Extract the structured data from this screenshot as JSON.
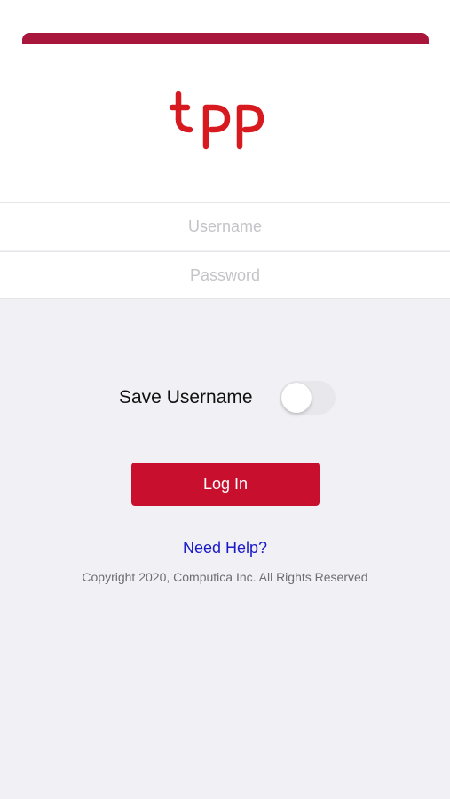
{
  "brand": {
    "logo_text": "tpp",
    "logo_color": "#d71920",
    "header_bar_color": "#a8163b"
  },
  "form": {
    "username": {
      "value": "",
      "placeholder": "Username"
    },
    "password": {
      "value": "",
      "placeholder": "Password"
    },
    "save_username": {
      "label": "Save Username",
      "enabled": false
    },
    "login_label": "Log In",
    "login_color": "#c8102e"
  },
  "footer": {
    "help_link": "Need Help?",
    "help_color": "#1a1ac8",
    "copyright": "Copyright 2020, Computica Inc. All Rights Reserved"
  }
}
